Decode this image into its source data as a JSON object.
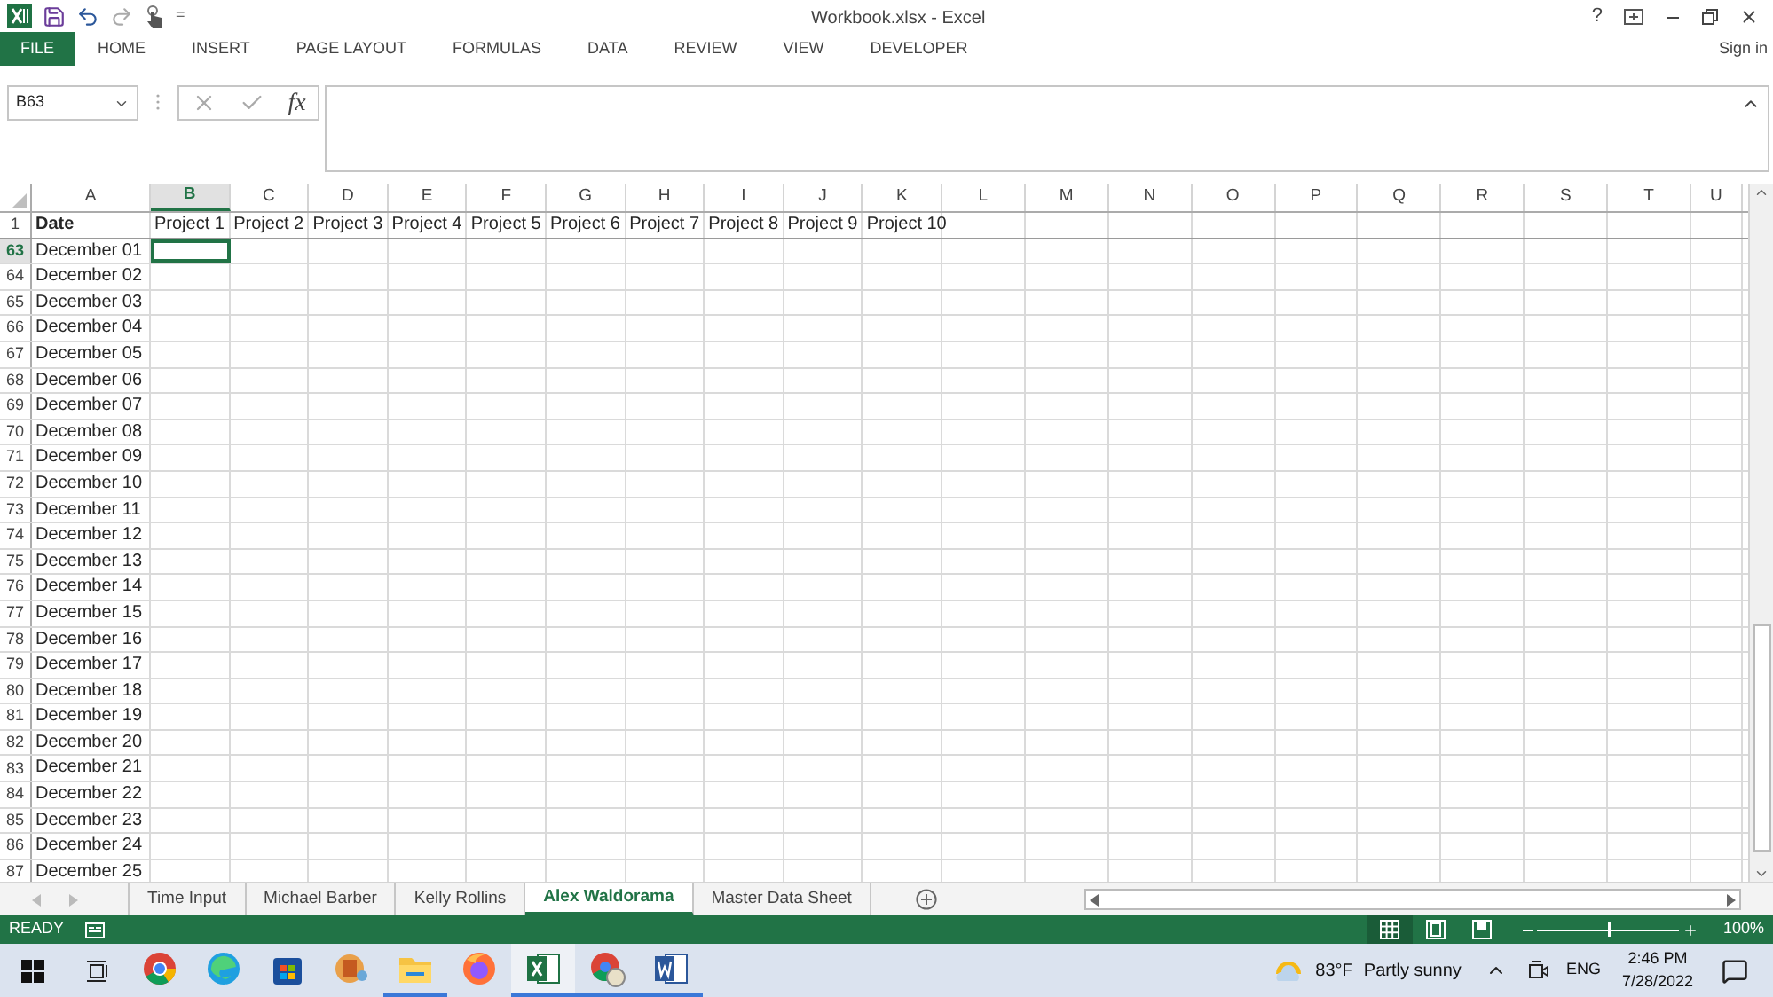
{
  "window": {
    "title": "Workbook.xlsx - Excel",
    "sign_in": "Sign in",
    "help": "?"
  },
  "quick_access": {
    "customize": "="
  },
  "ribbon_tabs": [
    {
      "label": "FILE",
      "selected": true
    },
    {
      "label": "HOME",
      "selected": false
    },
    {
      "label": "INSERT",
      "selected": false
    },
    {
      "label": "PAGE LAYOUT",
      "selected": false
    },
    {
      "label": "FORMULAS",
      "selected": false
    },
    {
      "label": "DATA",
      "selected": false
    },
    {
      "label": "REVIEW",
      "selected": false
    },
    {
      "label": "VIEW",
      "selected": false
    },
    {
      "label": "DEVELOPER",
      "selected": false
    }
  ],
  "formula_bar": {
    "name_box": "B63",
    "fx": "fx"
  },
  "columns": [
    {
      "letter": "A",
      "selected": false
    },
    {
      "letter": "B",
      "selected": true
    },
    {
      "letter": "C",
      "selected": false
    },
    {
      "letter": "D",
      "selected": false
    },
    {
      "letter": "E",
      "selected": false
    },
    {
      "letter": "F",
      "selected": false
    },
    {
      "letter": "G",
      "selected": false
    },
    {
      "letter": "H",
      "selected": false
    },
    {
      "letter": "I",
      "selected": false
    },
    {
      "letter": "J",
      "selected": false
    },
    {
      "letter": "K",
      "selected": false
    },
    {
      "letter": "L",
      "selected": false
    },
    {
      "letter": "M",
      "selected": false
    },
    {
      "letter": "N",
      "selected": false
    },
    {
      "letter": "O",
      "selected": false
    },
    {
      "letter": "P",
      "selected": false
    },
    {
      "letter": "Q",
      "selected": false
    },
    {
      "letter": "R",
      "selected": false
    },
    {
      "letter": "S",
      "selected": false
    },
    {
      "letter": "T",
      "selected": false
    },
    {
      "letter": "U",
      "selected": false
    }
  ],
  "rows": [
    {
      "number": "1",
      "selected": false,
      "cells": [
        "Date",
        "Project 1",
        "Project 2",
        "Project 3",
        "Project 4",
        "Project 5",
        "Project 6",
        "Project 7",
        "Project 8",
        "Project 9",
        "Project 10"
      ]
    },
    {
      "number": "63",
      "selected": true,
      "cells": [
        "December 01"
      ]
    },
    {
      "number": "64",
      "selected": false,
      "cells": [
        "December 02"
      ]
    },
    {
      "number": "65",
      "selected": false,
      "cells": [
        "December 03"
      ]
    },
    {
      "number": "66",
      "selected": false,
      "cells": [
        "December 04"
      ]
    },
    {
      "number": "67",
      "selected": false,
      "cells": [
        "December 05"
      ]
    },
    {
      "number": "68",
      "selected": false,
      "cells": [
        "December 06"
      ]
    },
    {
      "number": "69",
      "selected": false,
      "cells": [
        "December 07"
      ]
    },
    {
      "number": "70",
      "selected": false,
      "cells": [
        "December 08"
      ]
    },
    {
      "number": "71",
      "selected": false,
      "cells": [
        "December 09"
      ]
    },
    {
      "number": "72",
      "selected": false,
      "cells": [
        "December 10"
      ]
    },
    {
      "number": "73",
      "selected": false,
      "cells": [
        "December 11"
      ]
    },
    {
      "number": "74",
      "selected": false,
      "cells": [
        "December 12"
      ]
    },
    {
      "number": "75",
      "selected": false,
      "cells": [
        "December 13"
      ]
    },
    {
      "number": "76",
      "selected": false,
      "cells": [
        "December 14"
      ]
    },
    {
      "number": "77",
      "selected": false,
      "cells": [
        "December 15"
      ]
    },
    {
      "number": "78",
      "selected": false,
      "cells": [
        "December 16"
      ]
    },
    {
      "number": "79",
      "selected": false,
      "cells": [
        "December 17"
      ]
    },
    {
      "number": "80",
      "selected": false,
      "cells": [
        "December 18"
      ]
    },
    {
      "number": "81",
      "selected": false,
      "cells": [
        "December 19"
      ]
    },
    {
      "number": "82",
      "selected": false,
      "cells": [
        "December 20"
      ]
    },
    {
      "number": "83",
      "selected": false,
      "cells": [
        "December 21"
      ]
    },
    {
      "number": "84",
      "selected": false,
      "cells": [
        "December 22"
      ]
    },
    {
      "number": "85",
      "selected": false,
      "cells": [
        "December 23"
      ]
    },
    {
      "number": "86",
      "selected": false,
      "cells": [
        "December 24"
      ]
    },
    {
      "number": "87",
      "selected": false,
      "cells": [
        "December 25"
      ]
    }
  ],
  "sheet_tabs": [
    {
      "label": "Time Input",
      "selected": false
    },
    {
      "label": "Michael Barber",
      "selected": false
    },
    {
      "label": "Kelly Rollins",
      "selected": false
    },
    {
      "label": "Alex Waldorama",
      "selected": true
    },
    {
      "label": "Master Data Sheet",
      "selected": false
    }
  ],
  "status_bar": {
    "mode": "READY",
    "views": [
      {
        "kind": "normal",
        "selected": true
      },
      {
        "kind": "page_layout",
        "selected": false
      },
      {
        "kind": "page_break",
        "selected": false
      }
    ],
    "zoom": {
      "level": 0.5,
      "label": "100%"
    }
  },
  "taskbar": {
    "apps": [
      {
        "kind": "chrome",
        "open": false,
        "selected": false
      },
      {
        "kind": "edge",
        "open": false,
        "selected": false
      },
      {
        "kind": "store",
        "open": false,
        "selected": false
      },
      {
        "kind": "media",
        "open": false,
        "selected": false
      },
      {
        "kind": "explorer",
        "open": true,
        "selected": false
      },
      {
        "kind": "firefox",
        "open": false,
        "selected": false
      },
      {
        "kind": "excel",
        "open": true,
        "selected": true
      },
      {
        "kind": "chrome_profile",
        "open": true,
        "selected": false
      },
      {
        "kind": "word",
        "open": true,
        "selected": false
      }
    ],
    "weather": {
      "temperature": "83°F",
      "condition": "Partly sunny"
    },
    "language": "ENG",
    "time": "2:46 PM",
    "date": "7/28/2022"
  }
}
